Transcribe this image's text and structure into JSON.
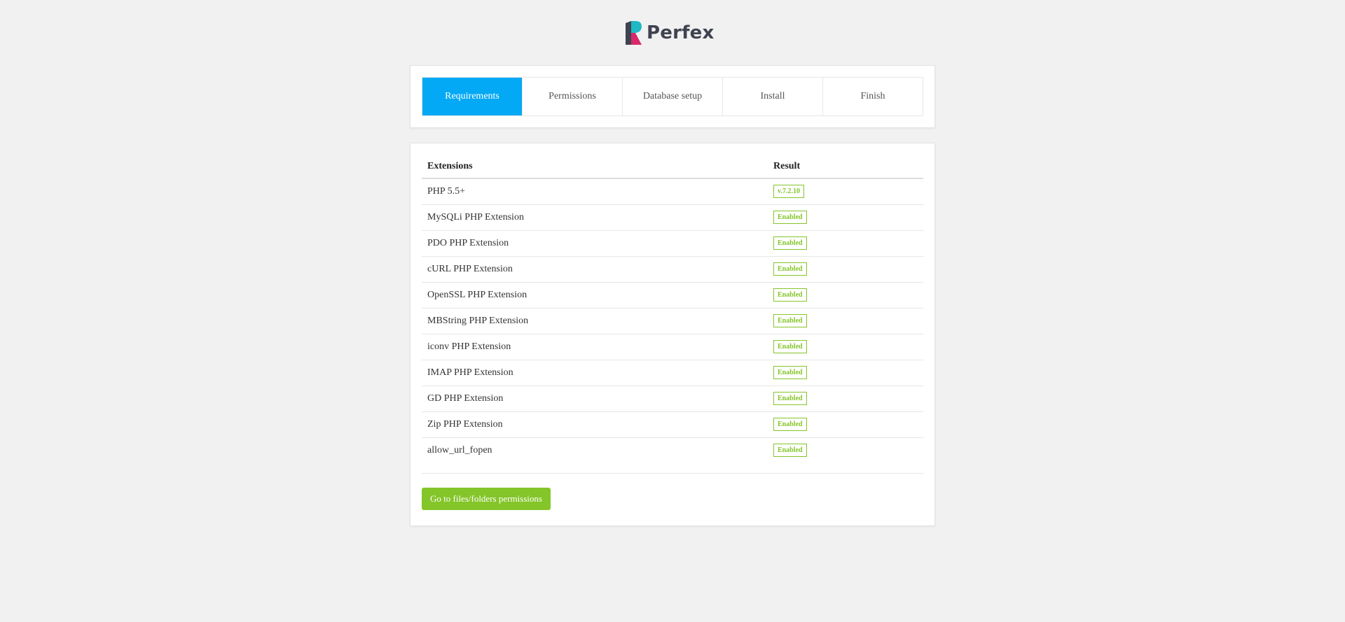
{
  "brand": {
    "name": "Perfex",
    "colors": {
      "teal": "#1fb8c4",
      "magenta": "#d8286a",
      "dark": "#3f4350"
    }
  },
  "steps": [
    {
      "label": "Requirements",
      "active": true
    },
    {
      "label": "Permissions",
      "active": false
    },
    {
      "label": "Database setup",
      "active": false
    },
    {
      "label": "Install",
      "active": false
    },
    {
      "label": "Finish",
      "active": false
    }
  ],
  "table": {
    "headers": {
      "extensions": "Extensions",
      "result": "Result"
    },
    "rows": [
      {
        "name": "PHP 5.5+",
        "result": "v.7.2.10"
      },
      {
        "name": "MySQLi PHP Extension",
        "result": "Enabled"
      },
      {
        "name": "PDO PHP Extension",
        "result": "Enabled"
      },
      {
        "name": "cURL PHP Extension",
        "result": "Enabled"
      },
      {
        "name": "OpenSSL PHP Extension",
        "result": "Enabled"
      },
      {
        "name": "MBString PHP Extension",
        "result": "Enabled"
      },
      {
        "name": "iconv PHP Extension",
        "result": "Enabled"
      },
      {
        "name": "IMAP PHP Extension",
        "result": "Enabled"
      },
      {
        "name": "GD PHP Extension",
        "result": "Enabled"
      },
      {
        "name": "Zip PHP Extension",
        "result": "Enabled"
      },
      {
        "name": "allow_url_fopen",
        "result": "Enabled"
      }
    ]
  },
  "actions": {
    "next_label": "Go to files/folders permissions"
  },
  "colors": {
    "accent": "#03a9f4",
    "success": "#84c529"
  }
}
